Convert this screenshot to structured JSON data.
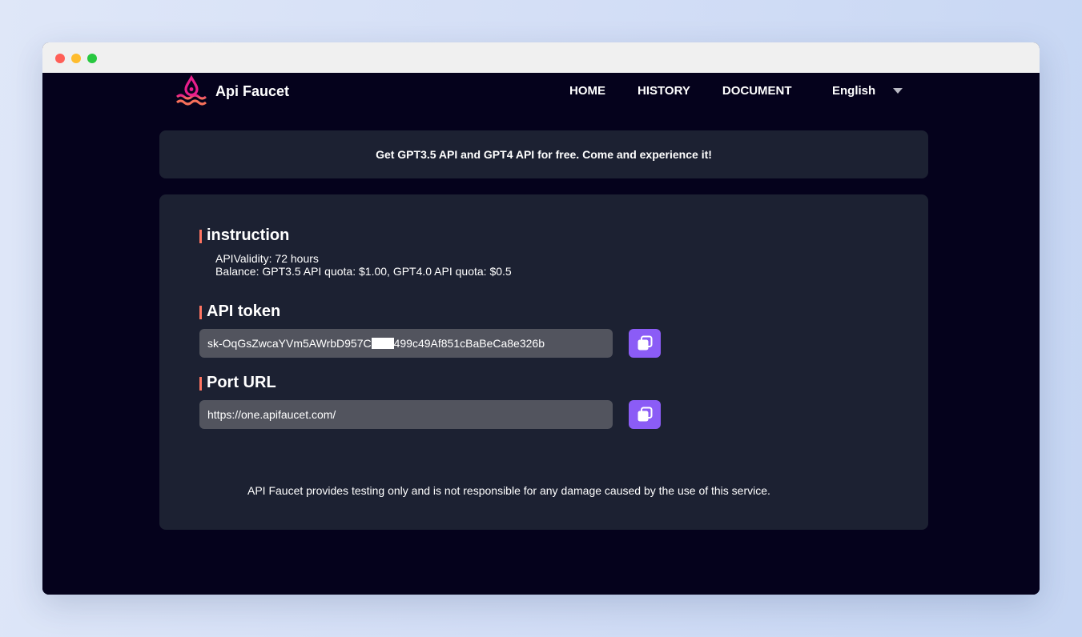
{
  "brand": {
    "name": "Api Faucet",
    "logo_icon": "water-drop-waves-logo"
  },
  "nav": {
    "items": [
      "HOME",
      "HISTORY",
      "DOCUMENT"
    ],
    "language": "English"
  },
  "banner": {
    "text": "Get GPT3.5 API and GPT4 API for free. Come and experience it!"
  },
  "instruction": {
    "title": "instruction",
    "lines": [
      "APIValidity: 72 hours",
      "Balance: GPT3.5 API quota: $1.00, GPT4.0 API quota: $0.5"
    ]
  },
  "api_token": {
    "title": "API token",
    "value_prefix": "sk-OqGsZwcaYVm5AWrbD957C",
    "value_suffix": "499c49Af851cBaBeCa8e326b",
    "copy_icon": "copy-icon"
  },
  "port_url": {
    "title": "Port URL",
    "value": "https://one.apifaucet.com/",
    "copy_icon": "copy-icon"
  },
  "disclaimer": "API Faucet provides testing only and is not responsible for any damage caused by the use of this service.",
  "colors": {
    "page_bg": "#05021c",
    "card_bg": "#1c2132",
    "field_bg": "#52545e",
    "accent_bar": "#ff7461",
    "button": "#8b5cf6"
  }
}
